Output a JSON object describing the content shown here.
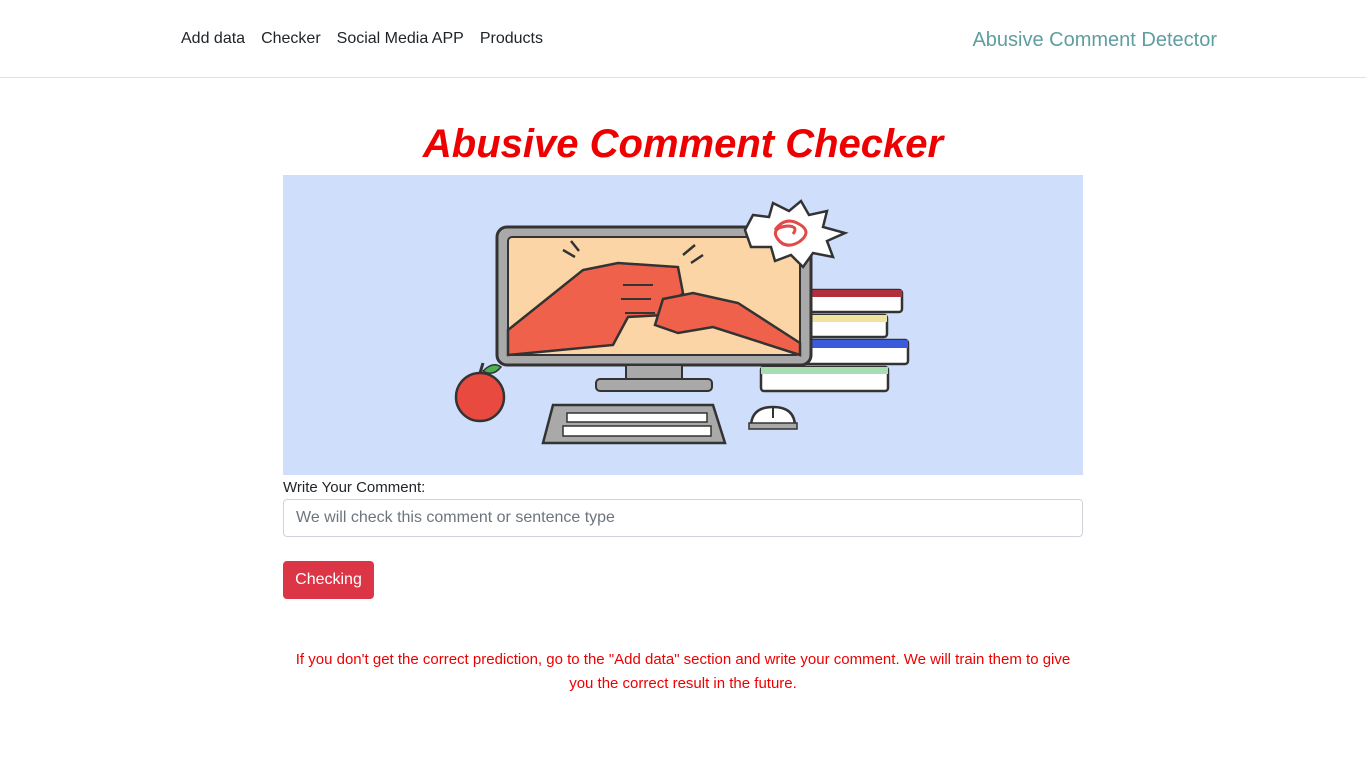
{
  "nav": {
    "items": [
      {
        "label": "Add data"
      },
      {
        "label": "Checker"
      },
      {
        "label": "Social Media APP"
      },
      {
        "label": "Products"
      }
    ],
    "brand": "Abusive Comment Detector"
  },
  "main": {
    "title": "Abusive Comment Checker",
    "comment_label": "Write Your Comment:",
    "comment_placeholder": "We will check this comment or sentence type",
    "comment_value": "",
    "check_button_label": "Checking",
    "info_text": "If you don't get the correct prediction, go to the \"Add data\" section and write your comment. We will train them to give you the correct result in the future."
  },
  "colors": {
    "title": "#ee0000",
    "brand": "#5f9ea0",
    "button": "#dc3545",
    "hero_background": "#cfdffb"
  }
}
